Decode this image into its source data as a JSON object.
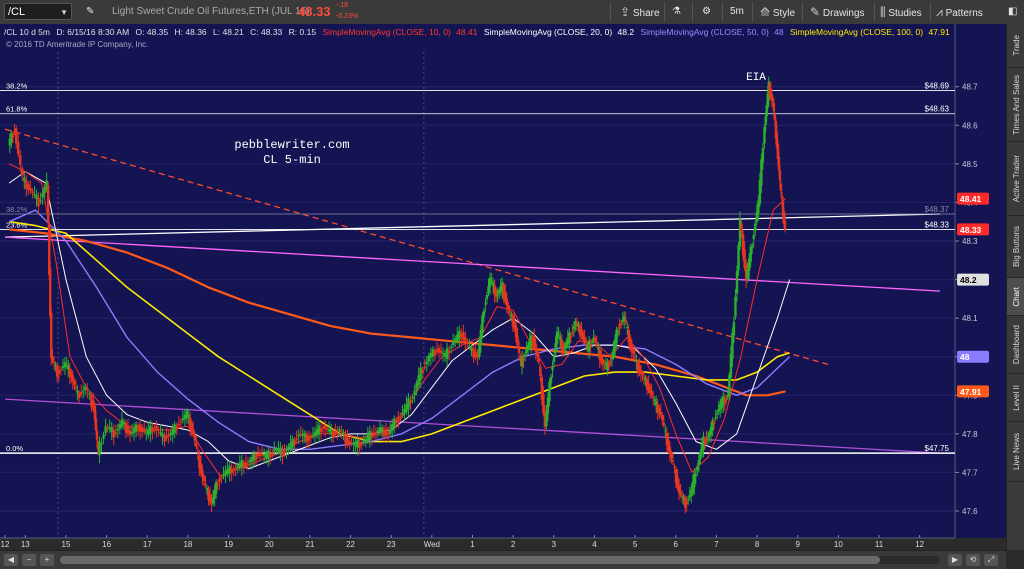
{
  "toolbar": {
    "symbol": "/CL",
    "instrument_name": "Light Sweet Crude Oil Futures,ETH (JUL 16)",
    "last_price": "48.33",
    "change": "-.18",
    "change_pct": "-0.23%",
    "share_label": "Share",
    "timeframe": "5m",
    "style_label": "Style",
    "drawings_label": "Drawings",
    "studies_label": "Studies",
    "patterns_label": "Patterns"
  },
  "info_bar": {
    "symbol_period": "/CL 10 d 5m",
    "date": "D: 6/15/16 8:30 AM",
    "open": "O: 48.35",
    "high": "H: 48.36",
    "low": "L: 48.21",
    "close": "C: 48.33",
    "range": "R: 0.15",
    "sma10_label": "SimpleMovingAvg (CLOSE, 10, 0)",
    "sma10_value": "48.41",
    "sma20_label": "SimpleMovingAvg (CLOSE, 20, 0)",
    "sma20_value": "48.2",
    "sma50_label": "SimpleMovingAvg (CLOSE, 50, 0)",
    "sma50_value": "48",
    "sma100_label": "SimpleMovingAvg (CLOSE, 100, 0)",
    "sma100_value": "47.91"
  },
  "copyright": "© 2016 TD Ameritrade IP Company, Inc.",
  "annotations": {
    "site": "pebblewriter.com",
    "subtitle": "CL 5-min",
    "event": "EIA"
  },
  "side_tabs": [
    "Trade",
    "Times And Sales",
    "Active Trader",
    "Big Buttons",
    "Chart",
    "Dashboard",
    "Level II",
    "Live News"
  ],
  "active_tab": "Chart",
  "colors": {
    "background": "#141452",
    "up": "#2bb02b",
    "down": "#e8361e",
    "sma10": "#ff2a2a",
    "sma20": "#ffffff",
    "sma50": "#8a7cff",
    "sma100": "#ffea00",
    "sma200": "#ff5a1a",
    "magenta": "#ff66ff",
    "fib": "#ffffff"
  },
  "chart_data": {
    "type": "candlestick",
    "ylim": [
      47.53,
      48.79
    ],
    "y_ticks": [
      47.6,
      47.7,
      47.8,
      47.9,
      48.0,
      48.1,
      48.2,
      48.3,
      48.4,
      48.5,
      48.6,
      48.7
    ],
    "y_tick_labels": [
      "47.6",
      "47.7",
      "47.8",
      "47.9",
      "48",
      "48.1",
      "48.2",
      "48.3",
      "48.4",
      "48.5",
      "48.6",
      "48.7"
    ],
    "x_labels": [
      "12",
      "13",
      "15",
      "16",
      "17",
      "18",
      "19",
      "20",
      "21",
      "22",
      "23",
      "Wed",
      "1",
      "2",
      "3",
      "4",
      "5",
      "6",
      "7",
      "8",
      "9",
      "10",
      "11",
      "12"
    ],
    "x_label_pos": [
      0,
      1,
      3,
      5,
      7,
      9,
      11,
      13,
      15,
      17,
      19,
      21,
      23,
      25,
      27,
      29,
      31,
      33,
      35,
      37,
      39,
      41,
      43,
      45
    ],
    "x_range": [
      0,
      46
    ],
    "price_series": [
      [
        0.2,
        48.55
      ],
      [
        0.5,
        48.59
      ],
      [
        0.9,
        48.46
      ],
      [
        1.3,
        48.43
      ],
      [
        1.7,
        48.4
      ],
      [
        2.1,
        48.45
      ],
      [
        2.3,
        48.0
      ],
      [
        2.6,
        47.96
      ],
      [
        3.0,
        47.98
      ],
      [
        3.3,
        47.95
      ],
      [
        3.6,
        47.9
      ],
      [
        4.0,
        47.92
      ],
      [
        4.4,
        47.87
      ],
      [
        4.6,
        47.75
      ],
      [
        5.0,
        47.82
      ],
      [
        5.4,
        47.8
      ],
      [
        5.8,
        47.83
      ],
      [
        6.2,
        47.8
      ],
      [
        6.6,
        47.82
      ],
      [
        7.0,
        47.8
      ],
      [
        7.4,
        47.82
      ],
      [
        7.8,
        47.79
      ],
      [
        8.2,
        47.8
      ],
      [
        8.6,
        47.83
      ],
      [
        9.0,
        47.85
      ],
      [
        9.3,
        47.8
      ],
      [
        9.6,
        47.72
      ],
      [
        9.9,
        47.66
      ],
      [
        10.2,
        47.62
      ],
      [
        10.5,
        47.68
      ],
      [
        10.9,
        47.7
      ],
      [
        11.3,
        47.71
      ],
      [
        11.7,
        47.72
      ],
      [
        12.1,
        47.73
      ],
      [
        12.5,
        47.75
      ],
      [
        12.9,
        47.74
      ],
      [
        13.3,
        47.76
      ],
      [
        13.7,
        47.75
      ],
      [
        14.1,
        47.77
      ],
      [
        14.5,
        47.8
      ],
      [
        14.9,
        47.79
      ],
      [
        15.3,
        47.8
      ],
      [
        15.7,
        47.82
      ],
      [
        16.1,
        47.8
      ],
      [
        16.5,
        47.81
      ],
      [
        16.9,
        47.78
      ],
      [
        17.3,
        47.77
      ],
      [
        17.7,
        47.78
      ],
      [
        18.1,
        47.8
      ],
      [
        18.5,
        47.81
      ],
      [
        18.9,
        47.8
      ],
      [
        19.3,
        47.84
      ],
      [
        19.7,
        47.86
      ],
      [
        20.1,
        47.9
      ],
      [
        20.5,
        47.96
      ],
      [
        20.9,
        48.0
      ],
      [
        21.3,
        48.02
      ],
      [
        21.7,
        48.0
      ],
      [
        22.1,
        48.04
      ],
      [
        22.5,
        48.06
      ],
      [
        22.9,
        48.02
      ],
      [
        23.3,
        48.0
      ],
      [
        23.6,
        48.13
      ],
      [
        23.9,
        48.2
      ],
      [
        24.2,
        48.16
      ],
      [
        24.5,
        48.18
      ],
      [
        24.8,
        48.12
      ],
      [
        25.1,
        48.08
      ],
      [
        25.4,
        47.98
      ],
      [
        25.7,
        48.02
      ],
      [
        26.0,
        48.05
      ],
      [
        26.3,
        47.98
      ],
      [
        26.6,
        47.82
      ],
      [
        26.9,
        47.96
      ],
      [
        27.2,
        48.06
      ],
      [
        27.5,
        48.02
      ],
      [
        27.8,
        48.05
      ],
      [
        28.1,
        48.09
      ],
      [
        28.4,
        48.06
      ],
      [
        28.7,
        48.02
      ],
      [
        29.0,
        48.05
      ],
      [
        29.3,
        48.0
      ],
      [
        29.6,
        47.97
      ],
      [
        29.9,
        48.0
      ],
      [
        30.2,
        48.08
      ],
      [
        30.5,
        48.1
      ],
      [
        30.8,
        48.03
      ],
      [
        31.1,
        47.98
      ],
      [
        31.4,
        47.95
      ],
      [
        31.7,
        47.92
      ],
      [
        32.0,
        47.88
      ],
      [
        32.3,
        47.85
      ],
      [
        32.6,
        47.78
      ],
      [
        32.9,
        47.72
      ],
      [
        33.2,
        47.65
      ],
      [
        33.5,
        47.62
      ],
      [
        33.8,
        47.65
      ],
      [
        34.1,
        47.72
      ],
      [
        34.4,
        47.78
      ],
      [
        34.7,
        47.8
      ],
      [
        35.0,
        47.85
      ],
      [
        35.3,
        47.88
      ],
      [
        35.6,
        47.9
      ],
      [
        35.9,
        48.1
      ],
      [
        36.2,
        48.35
      ],
      [
        36.5,
        48.2
      ],
      [
        36.8,
        48.3
      ],
      [
        37.1,
        48.4
      ],
      [
        37.4,
        48.6
      ],
      [
        37.6,
        48.7
      ],
      [
        37.8,
        48.66
      ],
      [
        38.0,
        48.55
      ],
      [
        38.2,
        48.42
      ],
      [
        38.4,
        48.33
      ]
    ],
    "sma10": [
      [
        0.2,
        48.5
      ],
      [
        1.0,
        48.48
      ],
      [
        1.8,
        48.45
      ],
      [
        2.5,
        48.25
      ],
      [
        3.2,
        48.0
      ],
      [
        4.0,
        47.92
      ],
      [
        5.0,
        47.86
      ],
      [
        6.0,
        47.82
      ],
      [
        7.0,
        47.81
      ],
      [
        8.0,
        47.81
      ],
      [
        9.0,
        47.82
      ],
      [
        9.8,
        47.75
      ],
      [
        10.6,
        47.69
      ],
      [
        11.5,
        47.71
      ],
      [
        12.5,
        47.73
      ],
      [
        13.5,
        47.75
      ],
      [
        14.5,
        47.78
      ],
      [
        15.5,
        47.8
      ],
      [
        16.5,
        47.8
      ],
      [
        17.5,
        47.79
      ],
      [
        18.5,
        47.8
      ],
      [
        19.5,
        47.84
      ],
      [
        20.5,
        47.93
      ],
      [
        21.5,
        48.0
      ],
      [
        22.5,
        48.03
      ],
      [
        23.4,
        48.05
      ],
      [
        24.2,
        48.13
      ],
      [
        25.0,
        48.12
      ],
      [
        25.8,
        48.04
      ],
      [
        26.6,
        47.97
      ],
      [
        27.4,
        47.98
      ],
      [
        28.2,
        48.04
      ],
      [
        29.0,
        48.04
      ],
      [
        29.8,
        48.0
      ],
      [
        30.6,
        48.05
      ],
      [
        31.4,
        48.0
      ],
      [
        32.2,
        47.92
      ],
      [
        33.0,
        47.8
      ],
      [
        33.8,
        47.7
      ],
      [
        34.6,
        47.74
      ],
      [
        35.4,
        47.84
      ],
      [
        36.2,
        48.0
      ],
      [
        37.0,
        48.2
      ],
      [
        37.8,
        48.38
      ],
      [
        38.4,
        48.41
      ]
    ],
    "sma20": [
      [
        0.2,
        48.45
      ],
      [
        1.0,
        48.48
      ],
      [
        2.0,
        48.45
      ],
      [
        3.0,
        48.2
      ],
      [
        4.0,
        48.0
      ],
      [
        5.0,
        47.9
      ],
      [
        6.0,
        47.85
      ],
      [
        7.0,
        47.83
      ],
      [
        8.0,
        47.82
      ],
      [
        9.0,
        47.81
      ],
      [
        10.0,
        47.78
      ],
      [
        11.0,
        47.73
      ],
      [
        12.0,
        47.71
      ],
      [
        13.0,
        47.73
      ],
      [
        14.0,
        47.75
      ],
      [
        15.0,
        47.77
      ],
      [
        16.0,
        47.79
      ],
      [
        17.0,
        47.8
      ],
      [
        18.0,
        47.8
      ],
      [
        19.0,
        47.81
      ],
      [
        20.0,
        47.85
      ],
      [
        21.0,
        47.92
      ],
      [
        22.0,
        47.99
      ],
      [
        23.0,
        48.03
      ],
      [
        24.0,
        48.07
      ],
      [
        25.0,
        48.1
      ],
      [
        26.0,
        48.06
      ],
      [
        27.0,
        48.0
      ],
      [
        28.0,
        48.01
      ],
      [
        29.0,
        48.03
      ],
      [
        30.0,
        48.03
      ],
      [
        31.0,
        48.02
      ],
      [
        32.0,
        47.97
      ],
      [
        33.0,
        47.88
      ],
      [
        34.0,
        47.78
      ],
      [
        35.0,
        47.76
      ],
      [
        36.0,
        47.8
      ],
      [
        37.0,
        47.95
      ],
      [
        38.0,
        48.1
      ],
      [
        38.6,
        48.2
      ]
    ],
    "sma50": [
      [
        0.2,
        48.35
      ],
      [
        1.5,
        48.38
      ],
      [
        3.0,
        48.3
      ],
      [
        4.5,
        48.18
      ],
      [
        6.0,
        48.05
      ],
      [
        7.5,
        47.96
      ],
      [
        9.0,
        47.89
      ],
      [
        10.5,
        47.83
      ],
      [
        12.0,
        47.78
      ],
      [
        13.5,
        47.76
      ],
      [
        15.0,
        47.76
      ],
      [
        16.5,
        47.77
      ],
      [
        18.0,
        47.78
      ],
      [
        19.5,
        47.8
      ],
      [
        21.0,
        47.84
      ],
      [
        22.5,
        47.9
      ],
      [
        24.0,
        47.96
      ],
      [
        25.5,
        48.0
      ],
      [
        27.0,
        48.02
      ],
      [
        28.5,
        48.03
      ],
      [
        30.0,
        48.03
      ],
      [
        31.5,
        48.02
      ],
      [
        33.0,
        47.98
      ],
      [
        34.5,
        47.93
      ],
      [
        36.0,
        47.9
      ],
      [
        37.0,
        47.92
      ],
      [
        38.0,
        47.97
      ],
      [
        38.6,
        48.0
      ]
    ],
    "sma100": [
      [
        0.2,
        48.35
      ],
      [
        1.5,
        48.34
      ],
      [
        3.0,
        48.32
      ],
      [
        4.5,
        48.25
      ],
      [
        6.0,
        48.18
      ],
      [
        7.5,
        48.12
      ],
      [
        9.0,
        48.06
      ],
      [
        10.5,
        48.0
      ],
      [
        12.0,
        47.95
      ],
      [
        13.5,
        47.9
      ],
      [
        15.0,
        47.85
      ],
      [
        16.5,
        47.8
      ],
      [
        18.0,
        47.78
      ],
      [
        19.5,
        47.78
      ],
      [
        21.0,
        47.8
      ],
      [
        22.5,
        47.83
      ],
      [
        24.0,
        47.86
      ],
      [
        25.5,
        47.89
      ],
      [
        27.0,
        47.92
      ],
      [
        28.5,
        47.95
      ],
      [
        30.0,
        47.96
      ],
      [
        31.5,
        47.96
      ],
      [
        33.0,
        47.95
      ],
      [
        34.5,
        47.94
      ],
      [
        36.0,
        47.94
      ],
      [
        37.0,
        47.96
      ],
      [
        38.0,
        48.0
      ],
      [
        38.6,
        48.01
      ]
    ],
    "sma200": [
      [
        0.2,
        48.33
      ],
      [
        2.0,
        48.32
      ],
      [
        4.0,
        48.3
      ],
      [
        6.0,
        48.27
      ],
      [
        8.0,
        48.23
      ],
      [
        10.0,
        48.18
      ],
      [
        12.0,
        48.14
      ],
      [
        14.0,
        48.11
      ],
      [
        16.0,
        48.08
      ],
      [
        18.0,
        48.06
      ],
      [
        20.0,
        48.05
      ],
      [
        22.0,
        48.04
      ],
      [
        24.0,
        48.03
      ],
      [
        26.0,
        48.02
      ],
      [
        28.0,
        48.01
      ],
      [
        30.0,
        48.0
      ],
      [
        32.0,
        47.98
      ],
      [
        34.0,
        47.95
      ],
      [
        35.5,
        47.92
      ],
      [
        36.5,
        47.9
      ],
      [
        37.5,
        47.9
      ],
      [
        38.4,
        47.91
      ]
    ],
    "fib_levels": [
      {
        "ratio": "38.2%",
        "price": 48.69
      },
      {
        "ratio": "61.8%",
        "price": 48.63
      },
      {
        "ratio": "38.2%",
        "price": 48.37
      },
      {
        "ratio": "23.6%",
        "price": 48.33
      },
      {
        "ratio": "0.0%",
        "price": 47.75
      }
    ],
    "fib_labels": [
      "$48.69",
      "$48.63",
      "$48.37",
      "$48.33",
      "$47.75"
    ],
    "trendlines": [
      {
        "style": "dashed",
        "color": "#ff4a2a",
        "from": [
          0,
          48.59
        ],
        "to": [
          40.5,
          47.98
        ]
      },
      {
        "style": "solid",
        "color": "#ffffff",
        "from": [
          0,
          48.31
        ],
        "to": [
          46,
          48.37
        ]
      },
      {
        "style": "solid",
        "color": "#ff66ff",
        "from": [
          0,
          48.31
        ],
        "to": [
          46,
          48.17
        ]
      },
      {
        "style": "solid",
        "color": "#b04fd8",
        "from": [
          0,
          47.89
        ],
        "to": [
          46,
          47.75
        ]
      }
    ],
    "price_tags": [
      {
        "label": "48.41",
        "price": 48.41,
        "color": "#ff2a2a"
      },
      {
        "label": "48.33",
        "price": 48.33,
        "color": "#ff2a2a"
      },
      {
        "label": "48.2",
        "price": 48.2,
        "color": "#e0e0e0"
      },
      {
        "label": "48",
        "price": 48.0,
        "color": "#8a7cff"
      },
      {
        "label": "47.91",
        "price": 47.91,
        "color": "#ff5a1a"
      }
    ]
  }
}
